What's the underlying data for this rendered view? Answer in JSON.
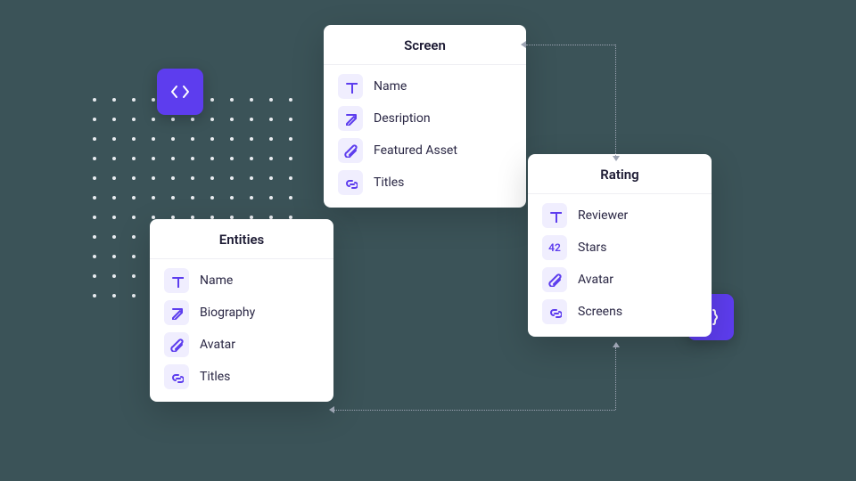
{
  "badges": {
    "code": "code-icon",
    "braces": "braces-icon"
  },
  "cards": {
    "screen": {
      "title": "Screen",
      "fields": [
        {
          "icon": "text-icon",
          "label": "Name"
        },
        {
          "icon": "edit-icon",
          "label": "Desription"
        },
        {
          "icon": "attach-icon",
          "label": "Featured Asset"
        },
        {
          "icon": "link-icon",
          "label": "Titles"
        }
      ]
    },
    "rating": {
      "title": "Rating",
      "fields": [
        {
          "icon": "text-icon",
          "label": "Reviewer"
        },
        {
          "icon": "number-icon",
          "glyph": "42",
          "label": "Stars"
        },
        {
          "icon": "attach-icon",
          "label": "Avatar"
        },
        {
          "icon": "link-icon",
          "label": "Screens"
        }
      ]
    },
    "entities": {
      "title": "Entities",
      "fields": [
        {
          "icon": "text-icon",
          "label": "Name"
        },
        {
          "icon": "edit-icon",
          "label": "Biography"
        },
        {
          "icon": "attach-icon",
          "label": "Avatar"
        },
        {
          "icon": "link-icon",
          "label": "Titles"
        }
      ]
    }
  }
}
